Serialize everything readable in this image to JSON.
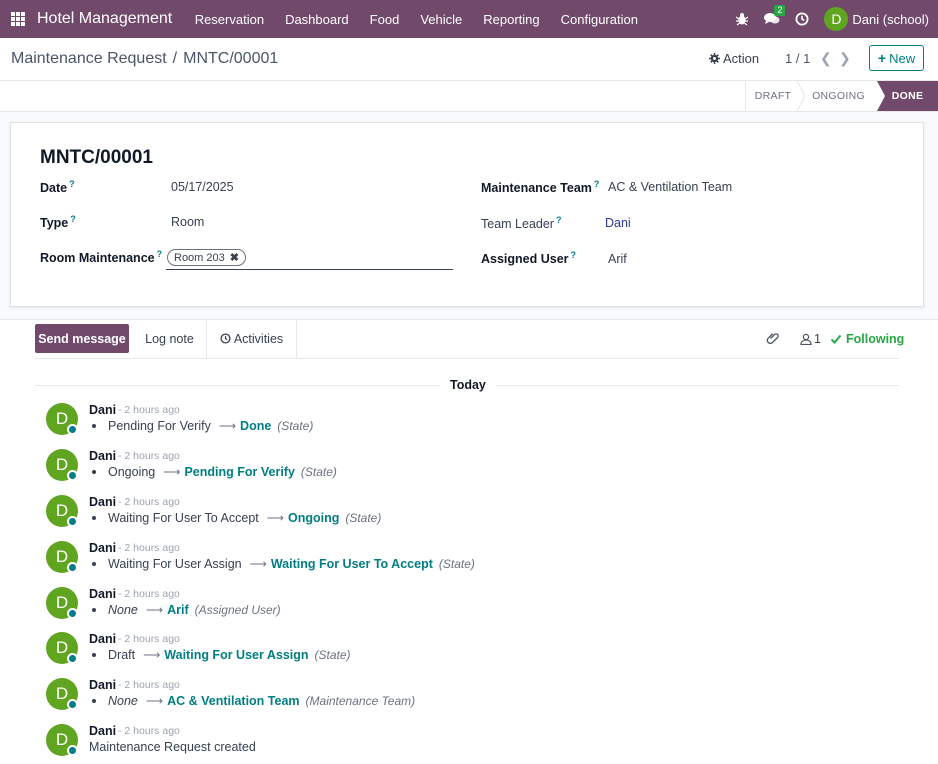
{
  "navbar": {
    "brand": "Hotel Management",
    "menu": [
      "Reservation",
      "Dashboard",
      "Food",
      "Vehicle",
      "Reporting",
      "Configuration"
    ],
    "message_count": "2",
    "user_initial": "D",
    "user_name": "Dani (school)",
    "color": "#71496b"
  },
  "control": {
    "breadcrumb_parent": "Maintenance Request",
    "breadcrumb_sep": "/",
    "breadcrumb_current": "MNTC/00001",
    "action_label": "Action",
    "pager": "1 / 1",
    "new_label": "New"
  },
  "statusbar": {
    "stages": [
      "DRAFT",
      "ONGOING",
      "DONE"
    ],
    "active": "DONE"
  },
  "form": {
    "name": "MNTC/00001",
    "date_label": "Date",
    "date_value": "05/17/2025",
    "type_label": "Type",
    "type_value": "Room",
    "room_label": "Room Maintenance",
    "room_tag": "Room 203",
    "team_label": "Maintenance Team",
    "team_value": "AC & Ventilation Team",
    "leader_label": "Team Leader",
    "leader_value": "Dani",
    "assigned_label": "Assigned User",
    "assigned_value": "Arif",
    "help_mark": "?"
  },
  "chatter": {
    "send_label": "Send message",
    "log_label": "Log note",
    "activities_label": "Activities",
    "followers": "1",
    "following_label": "Following",
    "today_label": "Today",
    "messages": [
      {
        "author": "Dani",
        "time": "- 2 hours ago",
        "old": "Pending For Verify",
        "old_italic": false,
        "new": "Done",
        "field": "(State)"
      },
      {
        "author": "Dani",
        "time": "- 2 hours ago",
        "old": "Ongoing",
        "old_italic": false,
        "new": "Pending For Verify",
        "field": "(State)"
      },
      {
        "author": "Dani",
        "time": "- 2 hours ago",
        "old": "Waiting For User To Accept",
        "old_italic": false,
        "new": "Ongoing",
        "field": "(State)"
      },
      {
        "author": "Dani",
        "time": "- 2 hours ago",
        "old": "Waiting For User Assign",
        "old_italic": false,
        "new": "Waiting For User To Accept",
        "field": "(State)"
      },
      {
        "author": "Dani",
        "time": "- 2 hours ago",
        "old": "None",
        "old_italic": true,
        "new": "Arif",
        "field": "(Assigned User)"
      },
      {
        "author": "Dani",
        "time": "- 2 hours ago",
        "old": "Draft",
        "old_italic": false,
        "new": "Waiting For User Assign",
        "field": "(State)"
      },
      {
        "author": "Dani",
        "time": "- 2 hours ago",
        "old": "None",
        "old_italic": true,
        "new": "AC & Ventilation Team",
        "field": "(Maintenance Team)"
      },
      {
        "author": "Dani",
        "time": "- 2 hours ago",
        "text": "Maintenance Request created"
      }
    ],
    "avatar_initial": "D"
  }
}
